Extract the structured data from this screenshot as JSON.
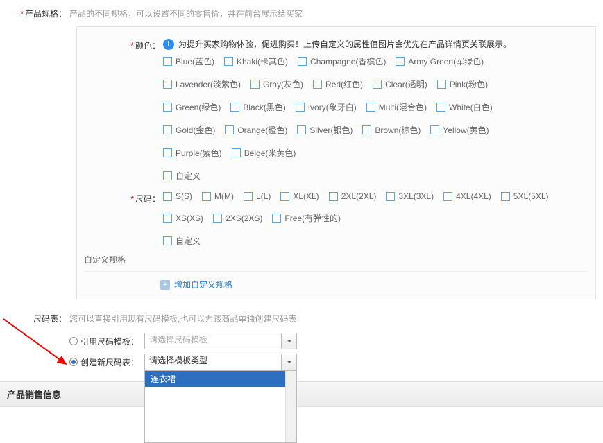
{
  "product_spec": {
    "label": "产品规格：",
    "desc": "产品的不同规格，可以设置不同的零售价，并在前台展示给买家"
  },
  "color": {
    "label": "颜色：",
    "info": "为提升买家购物体验，促进购买！上传自定义的属性值图片会优先在产品详情页关联展示。",
    "options": [
      "Blue(蓝色)",
      "Khaki(卡其色)",
      "Champagne(香槟色)",
      "Army Green(军绿色)",
      "Lavender(淡紫色)",
      "Gray(灰色)",
      "Red(红色)",
      "Clear(透明)",
      "Pink(粉色)",
      "Green(绿色)",
      "Black(黑色)",
      "Ivory(象牙白)",
      "Multi(混合色)",
      "White(白色)",
      "Gold(金色)",
      "Orange(橙色)",
      "Silver(银色)",
      "Brown(棕色)",
      "Yellow(黄色)",
      "Purple(紫色)",
      "Beige(米黄色)",
      "自定义"
    ]
  },
  "size": {
    "label": "尺码：",
    "options": [
      "S(S)",
      "M(M)",
      "L(L)",
      "XL(XL)",
      "2XL(2XL)",
      "3XL(3XL)",
      "4XL(4XL)",
      "5XL(5XL)",
      "XS(XS)",
      "2XS(2XS)",
      "Free(有弹性的)",
      "自定义"
    ]
  },
  "custom_spec_label": "自定义规格",
  "add_custom_spec": "增加自定义规格",
  "size_table": {
    "label": "尺码表：",
    "desc": "您可以直接引用现有尺码模板,也可以为该商品单独创建尺码表",
    "option1_label": "引用尺码模板：",
    "option1_placeholder": "请选择尺码模板",
    "option2_label": "创建新尺码表：",
    "option2_placeholder": "请选择模板类型",
    "dropdown_item": "连衣裙"
  },
  "sales_header": "产品销售信息"
}
